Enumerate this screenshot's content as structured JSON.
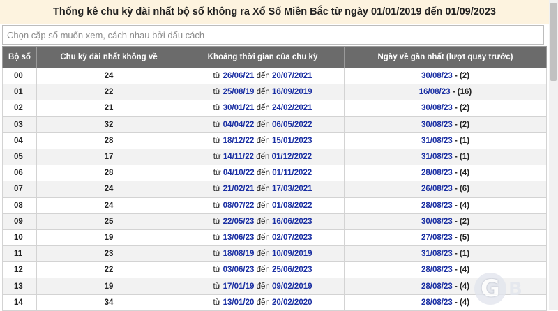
{
  "title": "Thống kê chu kỳ dài nhất bộ số không ra Xổ Số Miền Bắc từ ngày 01/01/2019 đến 01/09/2023",
  "search": {
    "placeholder": "Chọn cặp số muốn xem, cách nhau bởi dấu cách"
  },
  "table": {
    "headers": [
      "Bộ số",
      "Chu kỳ dài nhất không về",
      "Khoảng thời gian của chu kỳ",
      "Ngày về gần nhất (lượt quay trước)"
    ],
    "word_from": "từ",
    "word_to": "đến",
    "rows": [
      {
        "pair": "00",
        "cycle": "24",
        "from": "26/06/21",
        "to": "20/07/2021",
        "last": "30/08/23",
        "turns": "- (2)"
      },
      {
        "pair": "01",
        "cycle": "22",
        "from": "25/08/19",
        "to": "16/09/2019",
        "last": "16/08/23",
        "turns": "- (16)"
      },
      {
        "pair": "02",
        "cycle": "21",
        "from": "30/01/21",
        "to": "24/02/2021",
        "last": "30/08/23",
        "turns": "- (2)"
      },
      {
        "pair": "03",
        "cycle": "32",
        "from": "04/04/22",
        "to": "06/05/2022",
        "last": "30/08/23",
        "turns": "- (2)"
      },
      {
        "pair": "04",
        "cycle": "28",
        "from": "18/12/22",
        "to": "15/01/2023",
        "last": "31/08/23",
        "turns": "- (1)"
      },
      {
        "pair": "05",
        "cycle": "17",
        "from": "14/11/22",
        "to": "01/12/2022",
        "last": "31/08/23",
        "turns": "- (1)"
      },
      {
        "pair": "06",
        "cycle": "28",
        "from": "04/10/22",
        "to": "01/11/2022",
        "last": "28/08/23",
        "turns": "- (4)"
      },
      {
        "pair": "07",
        "cycle": "24",
        "from": "21/02/21",
        "to": "17/03/2021",
        "last": "26/08/23",
        "turns": "- (6)"
      },
      {
        "pair": "08",
        "cycle": "24",
        "from": "08/07/22",
        "to": "01/08/2022",
        "last": "28/08/23",
        "turns": "- (4)"
      },
      {
        "pair": "09",
        "cycle": "25",
        "from": "22/05/23",
        "to": "16/06/2023",
        "last": "30/08/23",
        "turns": "- (2)"
      },
      {
        "pair": "10",
        "cycle": "19",
        "from": "13/06/23",
        "to": "02/07/2023",
        "last": "27/08/23",
        "turns": "- (5)"
      },
      {
        "pair": "11",
        "cycle": "23",
        "from": "18/08/19",
        "to": "10/09/2019",
        "last": "31/08/23",
        "turns": "- (1)"
      },
      {
        "pair": "12",
        "cycle": "22",
        "from": "03/06/23",
        "to": "25/06/2023",
        "last": "28/08/23",
        "turns": "- (4)"
      },
      {
        "pair": "13",
        "cycle": "19",
        "from": "17/01/19",
        "to": "09/02/2019",
        "last": "28/08/23",
        "turns": "- (4)"
      },
      {
        "pair": "14",
        "cycle": "34",
        "from": "13/01/20",
        "to": "20/02/2020",
        "last": "28/08/23",
        "turns": "- (4)"
      }
    ]
  },
  "watermark": {
    "logo_letter": "G",
    "logo_text": "B"
  },
  "colors": {
    "header_bg": "#6b6b6b",
    "title_bg": "#fdf3df",
    "date_link": "#1a2fa3"
  }
}
